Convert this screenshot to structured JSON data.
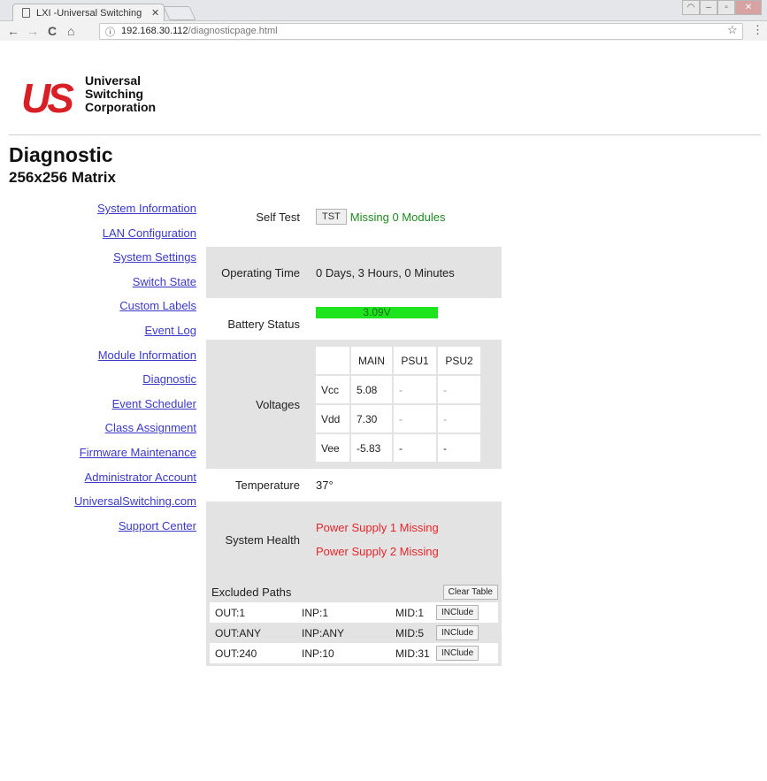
{
  "browser": {
    "tab_title": "LXI -Universal Switching",
    "tab_close": "✕",
    "url_host": "192.168.30.112",
    "url_path": "/diagnosticpage.html"
  },
  "logo": {
    "mark": "US",
    "line1": "Universal",
    "line2": "Switching",
    "line3": "Corporation"
  },
  "page": {
    "title": "Diagnostic",
    "subtitle": "256x256 Matrix"
  },
  "nav": [
    "System Information",
    "LAN Configuration",
    "System Settings",
    "Switch State",
    "Custom Labels",
    "Event Log",
    "Module Information",
    "Diagnostic",
    "Event Scheduler",
    "Class Assignment",
    "Firmware Maintenance",
    "Administrator Account",
    "UniversalSwitching.com",
    "Support Center"
  ],
  "self_test": {
    "label": "Self Test",
    "button": "TST",
    "status": "Missing 0 Modules"
  },
  "operating_time": {
    "label": "Operating Time",
    "value": "0 Days, 3 Hours, 0 Minutes"
  },
  "battery": {
    "label": "Battery Status",
    "value": "3.09V",
    "color": "#1ee41e"
  },
  "voltages": {
    "label": "Voltages",
    "headers": [
      "",
      "MAIN",
      "PSU1",
      "PSU2"
    ],
    "rows": [
      {
        "name": "Vcc",
        "main": "5.08",
        "psu1": "-",
        "psu2": "-"
      },
      {
        "name": "Vdd",
        "main": "7.30",
        "psu1": "-",
        "psu2": "-"
      },
      {
        "name": "Vee",
        "main": "-5.83",
        "psu1": "-",
        "psu2": "-"
      }
    ]
  },
  "temperature": {
    "label": "Temperature",
    "value": "37°"
  },
  "system_health": {
    "label": "System Health",
    "messages": [
      "Power Supply 1 Missing",
      "Power Supply 2 Missing"
    ],
    "color": "#e5262a"
  },
  "excluded_paths": {
    "title": "Excluded Paths",
    "clear_button": "Clear Table",
    "rows": [
      {
        "out": "OUT:1",
        "inp": "INP:1",
        "mid": "MID:1",
        "action": "INClude"
      },
      {
        "out": "OUT:ANY",
        "inp": "INP:ANY",
        "mid": "MID:5",
        "action": "INClude"
      },
      {
        "out": "OUT:240",
        "inp": "INP:10",
        "mid": "MID:31",
        "action": "INClude"
      }
    ]
  }
}
